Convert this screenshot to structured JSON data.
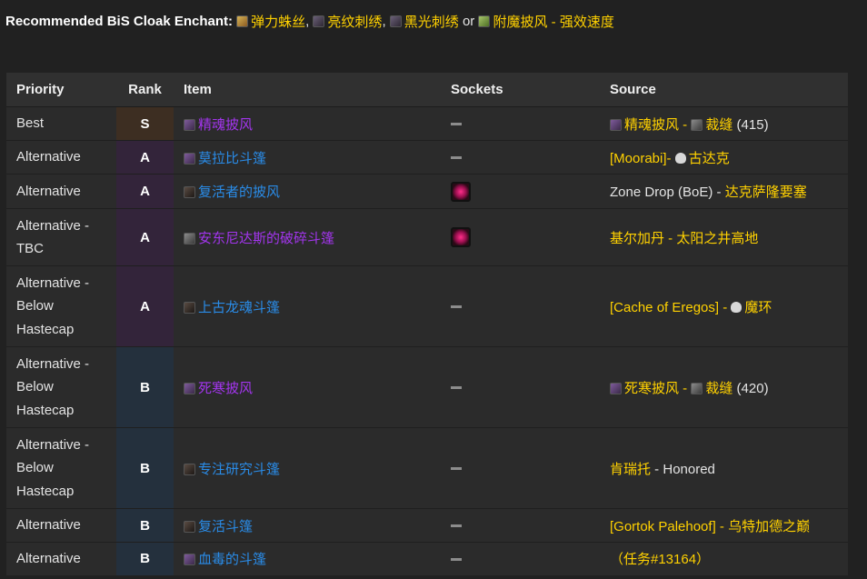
{
  "enchant": {
    "lead": "Recommended BiS Cloak Enchant:",
    "items": [
      {
        "icon": "scroll-icon",
        "label": "弹力蛛丝"
      },
      {
        "icon": "embroidery-icon",
        "label": "亮纹刺绣"
      },
      {
        "icon": "embroidery-icon",
        "label": "黑光刺绣"
      }
    ],
    "sep": ",",
    "or": "or",
    "last": {
      "icon": "enchant-scroll-icon",
      "label": "附魔披风 - 强效速度"
    }
  },
  "table": {
    "headers": {
      "priority": "Priority",
      "rank": "Rank",
      "item": "Item",
      "sockets": "Sockets",
      "source": "Source"
    },
    "rows": [
      {
        "priority": "Best",
        "rank": "S",
        "item": {
          "label": "精魂披风",
          "quality": "epic",
          "icon": "cloak-icon"
        },
        "socket": "none",
        "source": {
          "a": "精魂披风",
          "sep1": " - ",
          "b": "裁缝",
          "c": " (415)"
        }
      },
      {
        "priority": "Alternative",
        "rank": "A",
        "item": {
          "label": "莫拉比斗篷",
          "quality": "rare",
          "icon": "cloak-icon"
        },
        "socket": "none",
        "source": {
          "a": "[Moorabi]",
          "sep1": "- ",
          "b": "古达克"
        }
      },
      {
        "priority": "Alternative",
        "rank": "A",
        "item": {
          "label": "复活者的披风",
          "quality": "rare",
          "icon": "cloak-icon"
        },
        "socket": "prismatic",
        "source": {
          "a": "Zone Drop (BoE)",
          "sep1": " - ",
          "b": "达克萨隆要塞"
        }
      },
      {
        "priority": "Alternative - TBC",
        "rank": "A",
        "item": {
          "label": "安东尼达斯的破碎斗篷",
          "quality": "epic",
          "icon": "cloak-icon"
        },
        "socket": "prismatic",
        "source": {
          "a": "基尔加丹",
          "sep1": " - ",
          "b": "太阳之井高地"
        }
      },
      {
        "priority": "Alternative - Below Hastecap",
        "rank": "A",
        "item": {
          "label": "上古龙魂斗篷",
          "quality": "rare",
          "icon": "cloak-icon"
        },
        "socket": "none",
        "source": {
          "a": "[Cache of Eregos]",
          "sep1": " - ",
          "b": "魔环"
        }
      },
      {
        "priority": "Alternative - Below Hastecap",
        "rank": "B",
        "item": {
          "label": "死寒披风",
          "quality": "epic",
          "icon": "cloak-icon"
        },
        "socket": "none",
        "source": {
          "a": "死寒披风",
          "sep1": " - ",
          "b": "裁缝",
          "c": " (420)"
        }
      },
      {
        "priority": "Alternative - Below Hastecap",
        "rank": "B",
        "item": {
          "label": "专注研究斗篷",
          "quality": "rare",
          "icon": "cloak-icon"
        },
        "socket": "none",
        "source": {
          "a": "肯瑞托",
          "sep1": " - ",
          "b": "Honored"
        }
      },
      {
        "priority": "Alternative",
        "rank": "B",
        "item": {
          "label": "复活斗篷",
          "quality": "rare",
          "icon": "cloak-icon"
        },
        "socket": "none",
        "source": {
          "a": "[Gortok Palehoof]",
          "sep1": " - ",
          "b": "乌特加德之巅"
        }
      },
      {
        "priority": "Alternative",
        "rank": "B",
        "item": {
          "label": "血毒的斗篷",
          "quality": "rare",
          "icon": "cloak-icon"
        },
        "socket": "none",
        "source": {
          "a": "（任务#13164）"
        }
      }
    ]
  }
}
